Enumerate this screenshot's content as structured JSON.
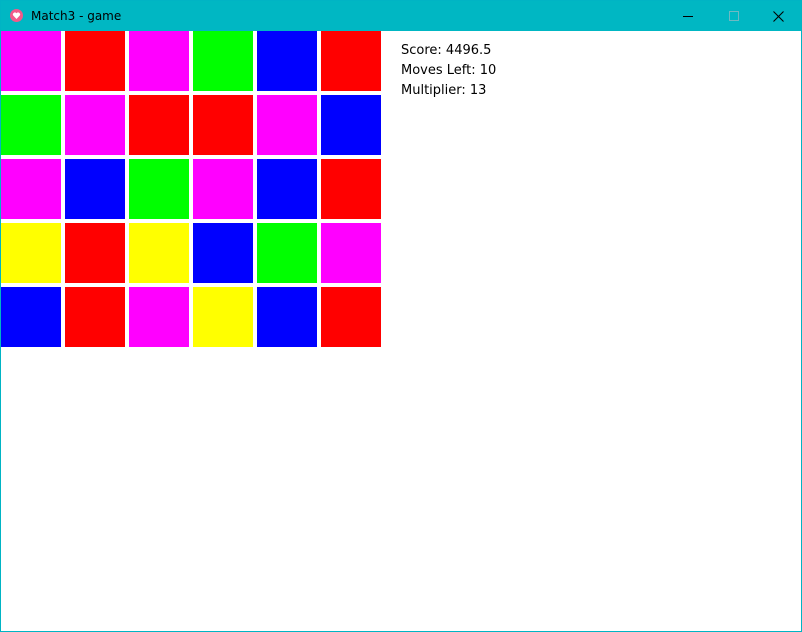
{
  "window": {
    "title": "Match3 - game",
    "titlebar_color": "#00b7c3",
    "icon": "heart-app-icon",
    "controls": [
      "minimize-icon",
      "maximize-icon",
      "close-icon"
    ]
  },
  "board": {
    "rows": 5,
    "cols": 6,
    "palette": {
      "magenta": "#ff00ff",
      "red": "#ff0000",
      "green": "#00ff00",
      "blue": "#0000ff",
      "yellow": "#ffff00"
    },
    "tiles": [
      [
        "magenta",
        "red",
        "magenta",
        "green",
        "blue",
        "red"
      ],
      [
        "green",
        "magenta",
        "red",
        "red",
        "magenta",
        "blue"
      ],
      [
        "magenta",
        "blue",
        "green",
        "magenta",
        "blue",
        "red"
      ],
      [
        "yellow",
        "red",
        "yellow",
        "blue",
        "green",
        "magenta"
      ],
      [
        "blue",
        "red",
        "magenta",
        "yellow",
        "blue",
        "red"
      ]
    ]
  },
  "hud": {
    "score": "Score: 4496.5",
    "moves_left": "Moves Left: 10",
    "multiplier": "Multiplier: 13"
  }
}
